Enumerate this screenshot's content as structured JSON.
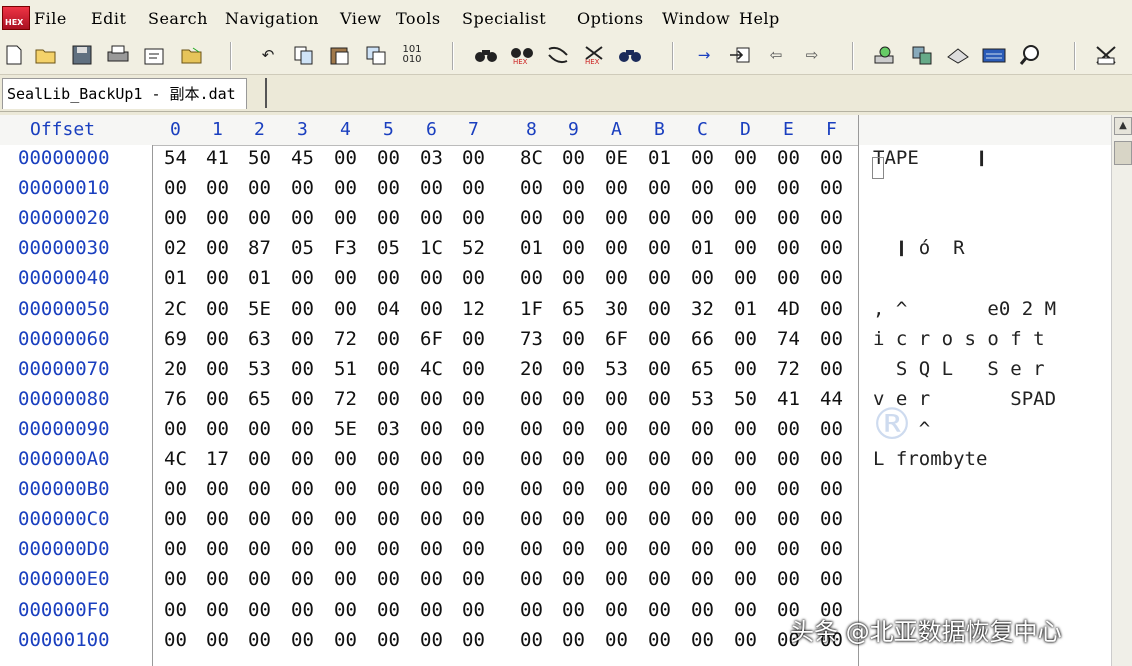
{
  "menu": [
    "File",
    "Edit",
    "Search",
    "Navigation",
    "View",
    "Tools",
    "Specialist",
    "Options",
    "Window",
    "Help"
  ],
  "app_icon_label": "HEX",
  "toolbar_icons": [
    "new-icon",
    "open-icon",
    "save-icon",
    "print-icon",
    "properties-icon",
    "open-folder-icon",
    "undo-icon",
    "copy-icon",
    "paste-icon",
    "clone-icon",
    "binary-icon",
    "find-icon",
    "find-hex-icon",
    "replace-icon",
    "replace-hex-icon",
    "find-next-icon",
    "go-to-icon",
    "jump-icon",
    "back-icon",
    "forward-icon",
    "disk-icon",
    "ram-icon",
    "drive-icon",
    "calculator-icon",
    "zoom-icon",
    "tools-icon"
  ],
  "tab": {
    "title": "SealLib_BackUp1 - 副本.dat"
  },
  "grid": {
    "offset_header": "Offset",
    "columns": [
      "0",
      "1",
      "2",
      "3",
      "4",
      "5",
      "6",
      "7",
      "8",
      "9",
      "A",
      "B",
      "C",
      "D",
      "E",
      "F"
    ],
    "rows": [
      {
        "offset": "00000000",
        "bytes": [
          "54",
          "41",
          "50",
          "45",
          "00",
          "00",
          "03",
          "00",
          "8C",
          "00",
          "0E",
          "01",
          "00",
          "00",
          "00",
          "00"
        ],
        "text": "TAPE     ❙"
      },
      {
        "offset": "00000010",
        "bytes": [
          "00",
          "00",
          "00",
          "00",
          "00",
          "00",
          "00",
          "00",
          "00",
          "00",
          "00",
          "00",
          "00",
          "00",
          "00",
          "00"
        ],
        "text": ""
      },
      {
        "offset": "00000020",
        "bytes": [
          "00",
          "00",
          "00",
          "00",
          "00",
          "00",
          "00",
          "00",
          "00",
          "00",
          "00",
          "00",
          "00",
          "00",
          "00",
          "00"
        ],
        "text": ""
      },
      {
        "offset": "00000030",
        "bytes": [
          "02",
          "00",
          "87",
          "05",
          "F3",
          "05",
          "1C",
          "52",
          "01",
          "00",
          "00",
          "00",
          "01",
          "00",
          "00",
          "00"
        ],
        "text": "  ❙ ó  R"
      },
      {
        "offset": "00000040",
        "bytes": [
          "01",
          "00",
          "01",
          "00",
          "00",
          "00",
          "00",
          "00",
          "00",
          "00",
          "00",
          "00",
          "00",
          "00",
          "00",
          "00"
        ],
        "text": ""
      },
      {
        "offset": "00000050",
        "bytes": [
          "2C",
          "00",
          "5E",
          "00",
          "00",
          "04",
          "00",
          "12",
          "1F",
          "65",
          "30",
          "00",
          "32",
          "01",
          "4D",
          "00"
        ],
        "text": ", ^       e0 2 M"
      },
      {
        "offset": "00000060",
        "bytes": [
          "69",
          "00",
          "63",
          "00",
          "72",
          "00",
          "6F",
          "00",
          "73",
          "00",
          "6F",
          "00",
          "66",
          "00",
          "74",
          "00"
        ],
        "text": "i c r o s o f t"
      },
      {
        "offset": "00000070",
        "bytes": [
          "20",
          "00",
          "53",
          "00",
          "51",
          "00",
          "4C",
          "00",
          "20",
          "00",
          "53",
          "00",
          "65",
          "00",
          "72",
          "00"
        ],
        "text": "  S Q L   S e r"
      },
      {
        "offset": "00000080",
        "bytes": [
          "76",
          "00",
          "65",
          "00",
          "72",
          "00",
          "00",
          "00",
          "00",
          "00",
          "00",
          "00",
          "53",
          "50",
          "41",
          "44"
        ],
        "text": "v e r       SPAD"
      },
      {
        "offset": "00000090",
        "bytes": [
          "00",
          "00",
          "00",
          "00",
          "5E",
          "03",
          "00",
          "00",
          "00",
          "00",
          "00",
          "00",
          "00",
          "00",
          "00",
          "00"
        ],
        "text": "    ^"
      },
      {
        "offset": "000000A0",
        "bytes": [
          "4C",
          "17",
          "00",
          "00",
          "00",
          "00",
          "00",
          "00",
          "00",
          "00",
          "00",
          "00",
          "00",
          "00",
          "00",
          "00"
        ],
        "text": "L frombyte"
      },
      {
        "offset": "000000B0",
        "bytes": [
          "00",
          "00",
          "00",
          "00",
          "00",
          "00",
          "00",
          "00",
          "00",
          "00",
          "00",
          "00",
          "00",
          "00",
          "00",
          "00"
        ],
        "text": ""
      },
      {
        "offset": "000000C0",
        "bytes": [
          "00",
          "00",
          "00",
          "00",
          "00",
          "00",
          "00",
          "00",
          "00",
          "00",
          "00",
          "00",
          "00",
          "00",
          "00",
          "00"
        ],
        "text": ""
      },
      {
        "offset": "000000D0",
        "bytes": [
          "00",
          "00",
          "00",
          "00",
          "00",
          "00",
          "00",
          "00",
          "00",
          "00",
          "00",
          "00",
          "00",
          "00",
          "00",
          "00"
        ],
        "text": ""
      },
      {
        "offset": "000000E0",
        "bytes": [
          "00",
          "00",
          "00",
          "00",
          "00",
          "00",
          "00",
          "00",
          "00",
          "00",
          "00",
          "00",
          "00",
          "00",
          "00",
          "00"
        ],
        "text": ""
      },
      {
        "offset": "000000F0",
        "bytes": [
          "00",
          "00",
          "00",
          "00",
          "00",
          "00",
          "00",
          "00",
          "00",
          "00",
          "00",
          "00",
          "00",
          "00",
          "00",
          "00"
        ],
        "text": ""
      },
      {
        "offset": "00000100",
        "bytes": [
          "00",
          "00",
          "00",
          "00",
          "00",
          "00",
          "00",
          "00",
          "00",
          "00",
          "00",
          "00",
          "00",
          "00",
          "00",
          "00"
        ],
        "text": ""
      }
    ]
  },
  "watermark": "®",
  "caption": "头条 @北亚数据恢复中心"
}
